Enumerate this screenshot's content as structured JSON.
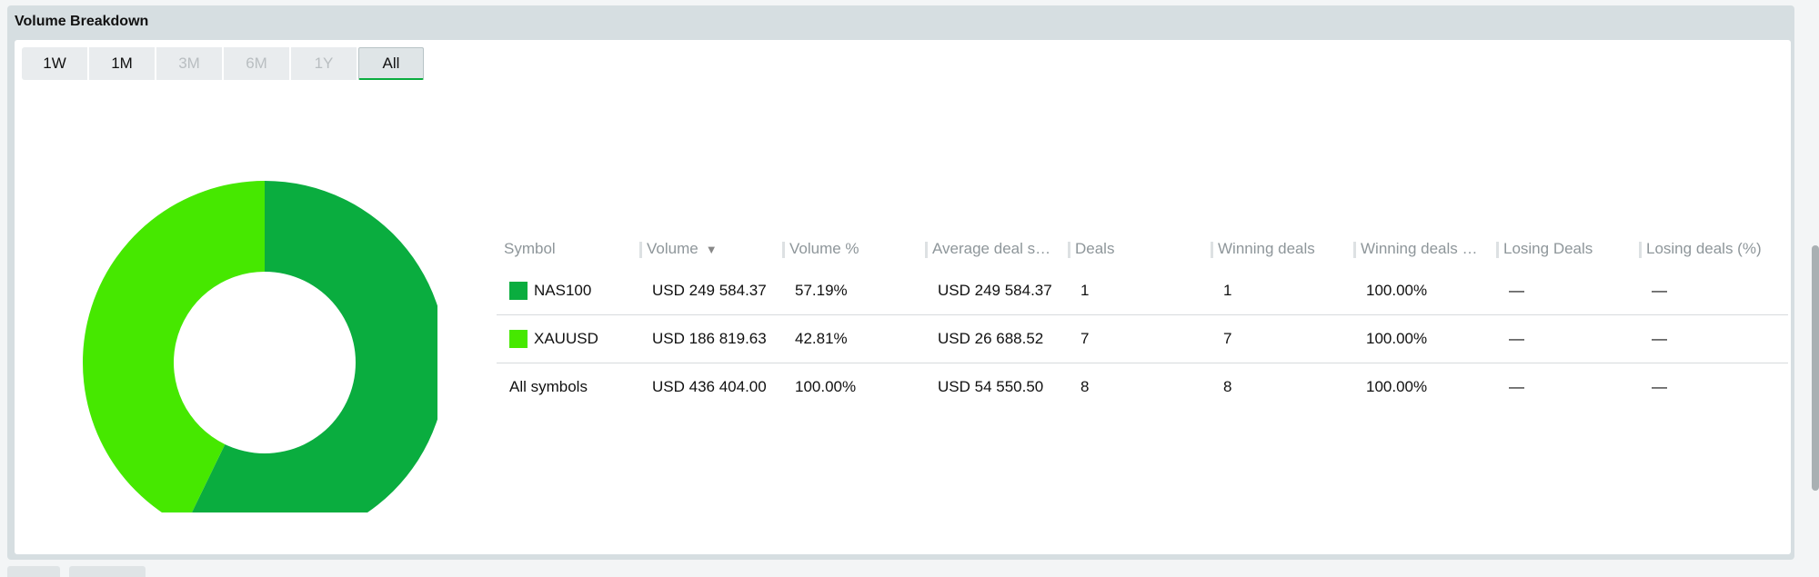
{
  "panel": {
    "title": "Volume Breakdown"
  },
  "periods": [
    {
      "label": "1W",
      "state": "enabled"
    },
    {
      "label": "1M",
      "state": "enabled"
    },
    {
      "label": "3M",
      "state": "disabled"
    },
    {
      "label": "6M",
      "state": "disabled"
    },
    {
      "label": "1Y",
      "state": "disabled"
    },
    {
      "label": "All",
      "state": "active"
    }
  ],
  "colors": {
    "nas100": "#0aad3f",
    "xauusd": "#46e800",
    "accent": "#0aad3f"
  },
  "table": {
    "headers": [
      "Symbol",
      "Volume",
      "Volume %",
      "Average deal s…",
      "Deals",
      "Winning deals",
      "Winning deals …",
      "Losing Deals",
      "Losing deals (%)"
    ],
    "sort_icon": "sort-down-icon",
    "rows": [
      {
        "symbol": "NAS100",
        "color": "#0aad3f",
        "volume": "USD 249 584.37",
        "volume_pct": "57.19%",
        "avg_deal": "USD 249 584.37",
        "deals": "1",
        "winning_deals": "1",
        "winning_pct": "100.00%",
        "losing_deals": "—",
        "losing_pct": "—"
      },
      {
        "symbol": "XAUUSD",
        "color": "#46e800",
        "volume": "USD 186 819.63",
        "volume_pct": "42.81%",
        "avg_deal": "USD 26 688.52",
        "deals": "7",
        "winning_deals": "7",
        "winning_pct": "100.00%",
        "losing_deals": "—",
        "losing_pct": "—"
      },
      {
        "symbol": "All symbols",
        "color": null,
        "volume": "USD 436 404.00",
        "volume_pct": "100.00%",
        "avg_deal": "USD 54 550.50",
        "deals": "8",
        "winning_deals": "8",
        "winning_pct": "100.00%",
        "losing_deals": "—",
        "losing_pct": "—"
      }
    ]
  },
  "chart_data": {
    "type": "pie",
    "categories": [
      "NAS100",
      "XAUUSD"
    ],
    "values": [
      57.19,
      42.81
    ],
    "colors": [
      "#0aad3f",
      "#46e800"
    ],
    "donut": true
  }
}
